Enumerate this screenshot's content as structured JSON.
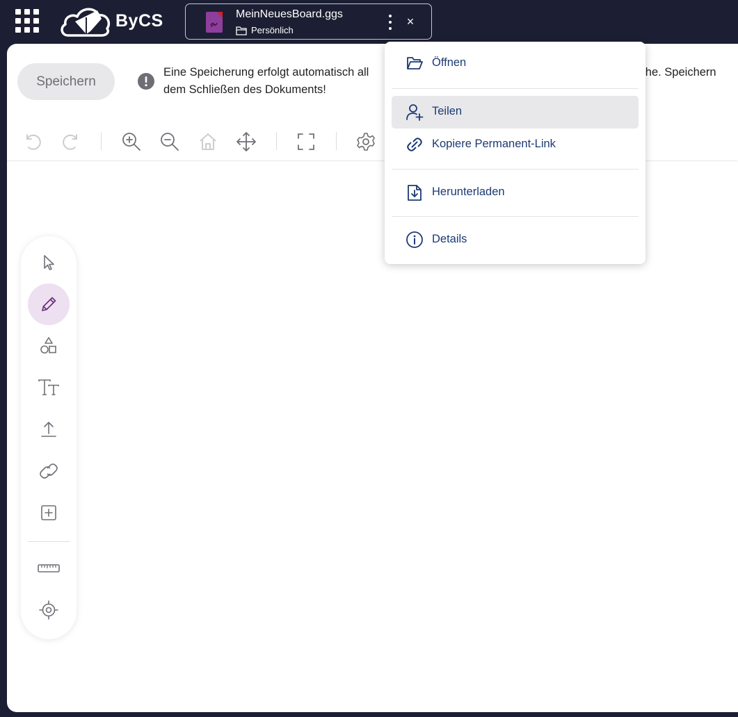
{
  "app": {
    "logo_text": "ByCS"
  },
  "document": {
    "title": "MeinNeuesBoard.ggs",
    "folder": "Persönlich",
    "close_glyph": "×"
  },
  "main": {
    "save_label": "Speichern",
    "info_line1_left": "Eine Speicherung erfolgt automatisch all",
    "info_line1_right": "äche. Speichern",
    "info_line2": "dem Schließen des Dokuments!"
  },
  "toolbar": {
    "icons": [
      "undo-icon",
      "redo-icon",
      "zoom-in-icon",
      "zoom-out-icon",
      "home-icon",
      "move-icon",
      "fullscreen-icon",
      "settings-icon"
    ]
  },
  "side_tools": {
    "icons": [
      "select-arrow-icon",
      "pencil-icon",
      "shapes-icon",
      "text-icon",
      "upload-icon",
      "link-icon",
      "add-box-icon",
      "ruler-icon",
      "target-icon"
    ],
    "active": "pencil-icon"
  },
  "menu": {
    "items": [
      {
        "label": "Öffnen",
        "icon": "folder-open-icon"
      },
      {
        "label": "Teilen",
        "icon": "add-person-icon"
      },
      {
        "label": "Kopiere Permanent-Link",
        "icon": "link-icon"
      },
      {
        "label": "Herunterladen",
        "icon": "download-icon"
      },
      {
        "label": "Details",
        "icon": "info-circle-icon"
      }
    ]
  },
  "colors": {
    "background": "#1c1f33",
    "menu_text": "#1b3a73",
    "active_tool": "#ece0f1",
    "file_icon": "#8e3f9c"
  }
}
